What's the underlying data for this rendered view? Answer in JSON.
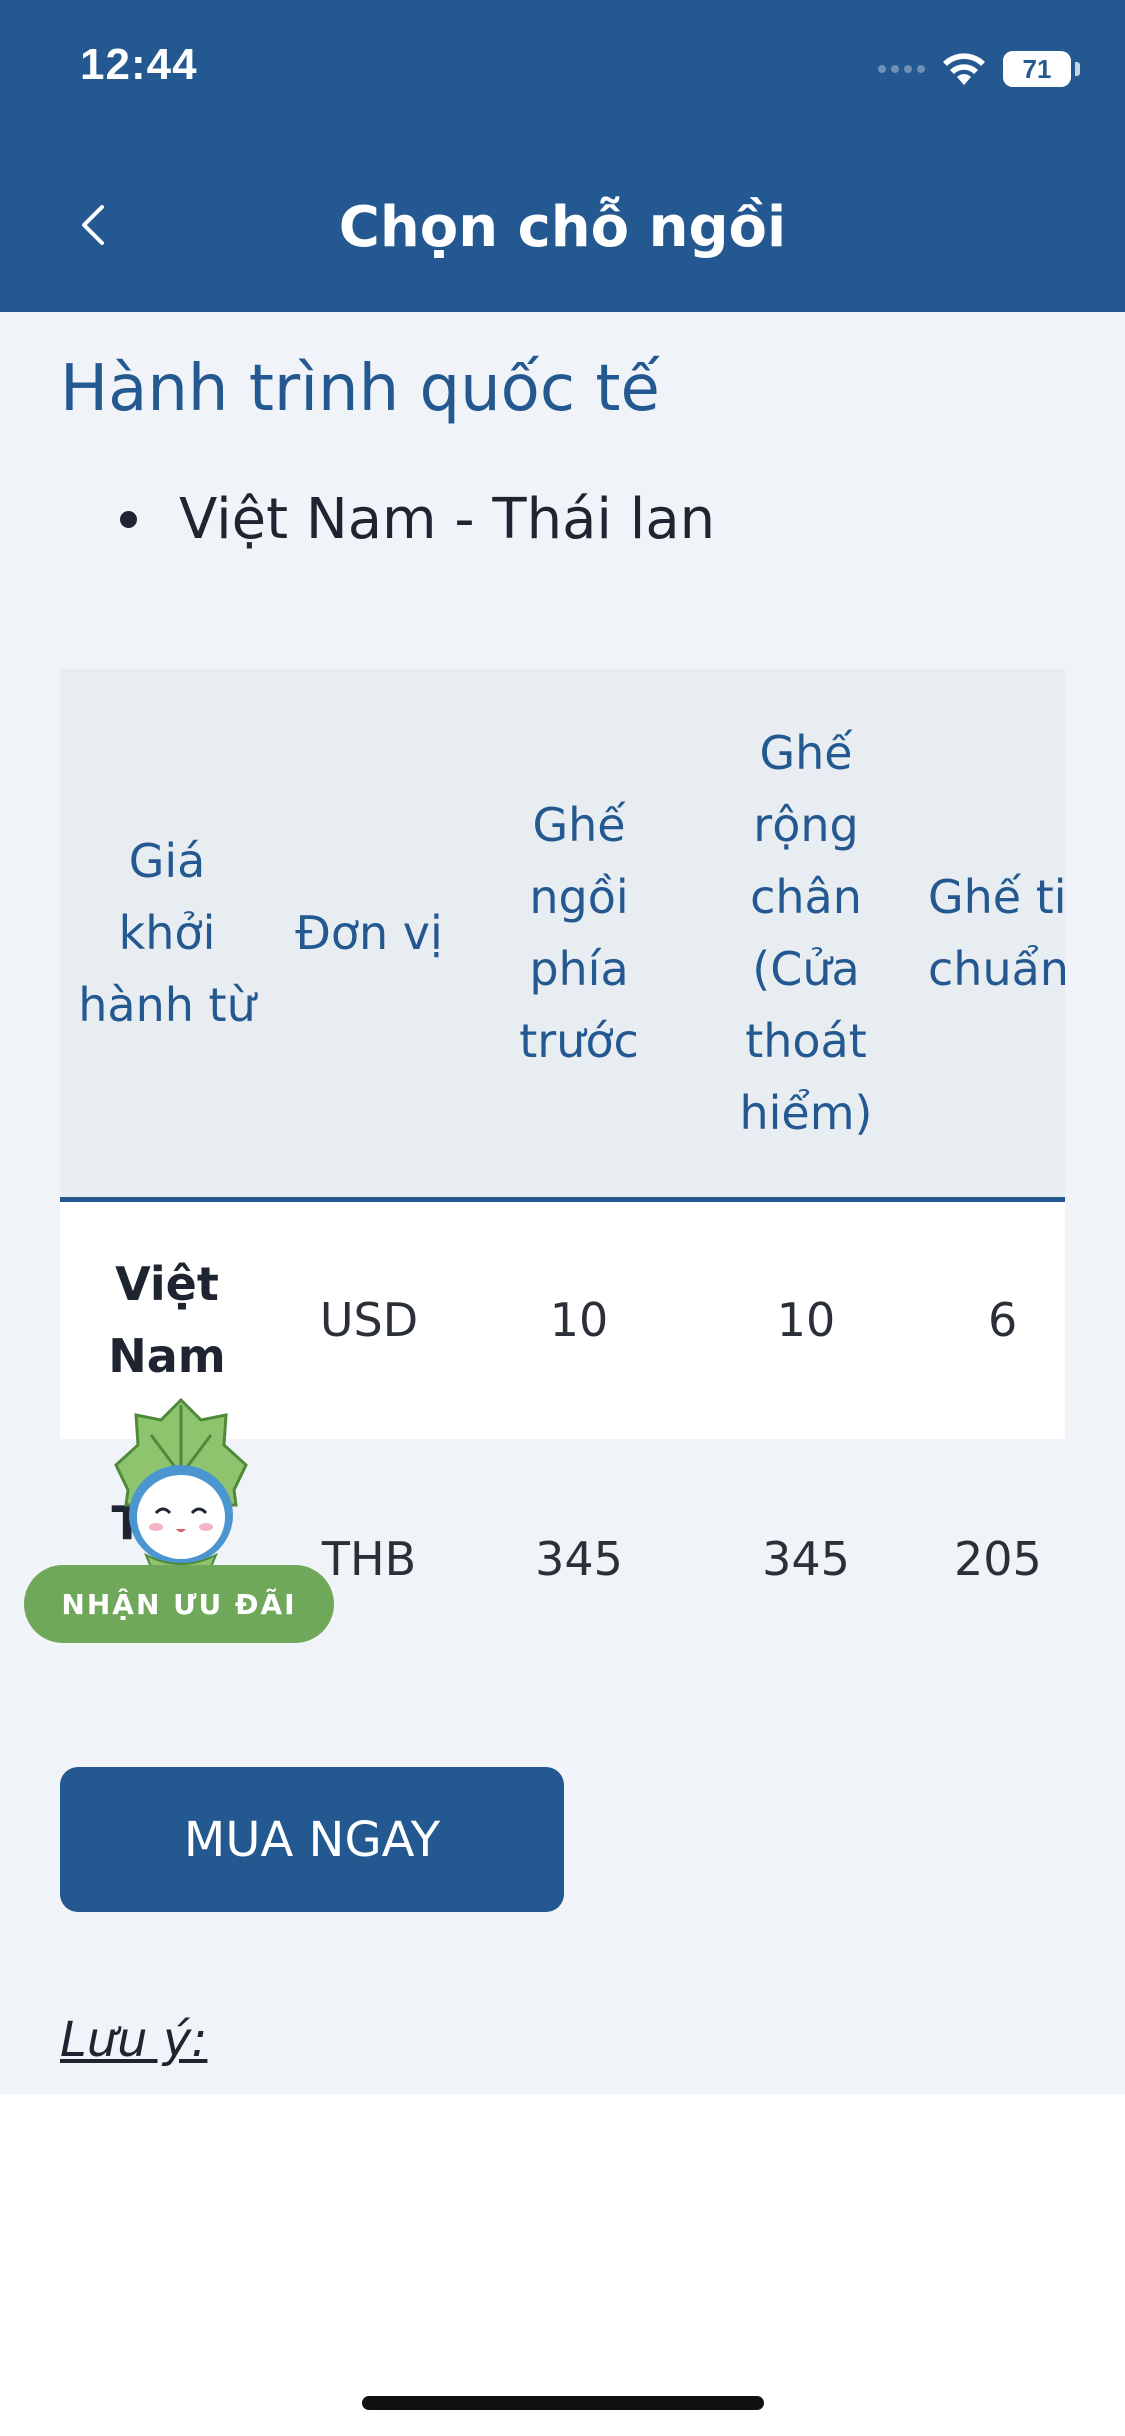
{
  "status_bar": {
    "time": "12:44",
    "battery": "71"
  },
  "header": {
    "title": "Chọn chỗ ngồi"
  },
  "section": {
    "title": "Hành trình quốc tế",
    "routes": [
      "Việt Nam - Thái lan"
    ]
  },
  "table": {
    "headers": [
      "Giá khởi hành từ",
      "Đơn vị",
      "Ghế ngồi phía trước",
      "Ghế rộng chân (Cửa thoát hiểm)",
      "Ghế tiêu chuẩn"
    ],
    "rows": [
      {
        "country": "Việt Nam",
        "unit": "USD",
        "front": "10",
        "legroom": "10",
        "standard": "6"
      },
      {
        "country": "Thái Lan",
        "unit": "THB",
        "front": "345",
        "legroom": "345",
        "standard": "205"
      }
    ]
  },
  "buy_button": {
    "label": "MUA NGAY"
  },
  "note": {
    "label": "Lưu ý:"
  },
  "promo": {
    "label": "NHẬN ƯU ĐÃI"
  },
  "colors": {
    "brand": "#235890",
    "background": "#f0f3f7",
    "promo": "#6fa85a"
  }
}
